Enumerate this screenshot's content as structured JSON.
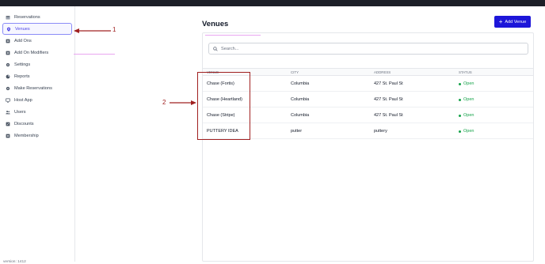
{
  "sidebar": {
    "items": [
      {
        "label": "Reservations",
        "icon": "calendar-icon"
      },
      {
        "label": "Venues",
        "icon": "location-pin-icon",
        "active": true
      },
      {
        "label": "Add Ons",
        "icon": "plus-square-icon"
      },
      {
        "label": "Add On Modifiers",
        "icon": "plus-square-icon"
      },
      {
        "label": "Settings",
        "icon": "gear-icon"
      },
      {
        "label": "Reports",
        "icon": "pie-chart-icon"
      },
      {
        "label": "Make Reservations",
        "icon": "gear-icon"
      },
      {
        "label": "Host App",
        "icon": "monitor-icon"
      },
      {
        "label": "Users",
        "icon": "users-icon"
      },
      {
        "label": "Discounts",
        "icon": "tag-icon"
      },
      {
        "label": "Membership",
        "icon": "id-card-icon"
      }
    ],
    "version": "version: 1412"
  },
  "header": {
    "title": "Venues",
    "add_button": "Add Venue"
  },
  "search": {
    "placeholder": "Search..."
  },
  "table": {
    "columns": [
      "VENUE",
      "CITY",
      "ADDRESS",
      "STATUS"
    ],
    "rows": [
      {
        "venue": "Chase (Fortis)",
        "city": "Columbia",
        "address": "427 St. Paul St",
        "status": "Open"
      },
      {
        "venue": "Chase (Heartland)",
        "city": "Columbia",
        "address": "427 St. Paul St",
        "status": "Open"
      },
      {
        "venue": "Chase (Stripe)",
        "city": "Columbia",
        "address": "427 St. Paul St",
        "status": "Open"
      },
      {
        "venue": "PUTTERY IDEA",
        "city": "putter",
        "address": "puttery",
        "status": "Open"
      }
    ]
  },
  "annotations": {
    "one": "1",
    "two": "2"
  },
  "colors": {
    "accent": "#1d16d9",
    "annotation": "#a02020",
    "status_open": "#16a34a"
  }
}
